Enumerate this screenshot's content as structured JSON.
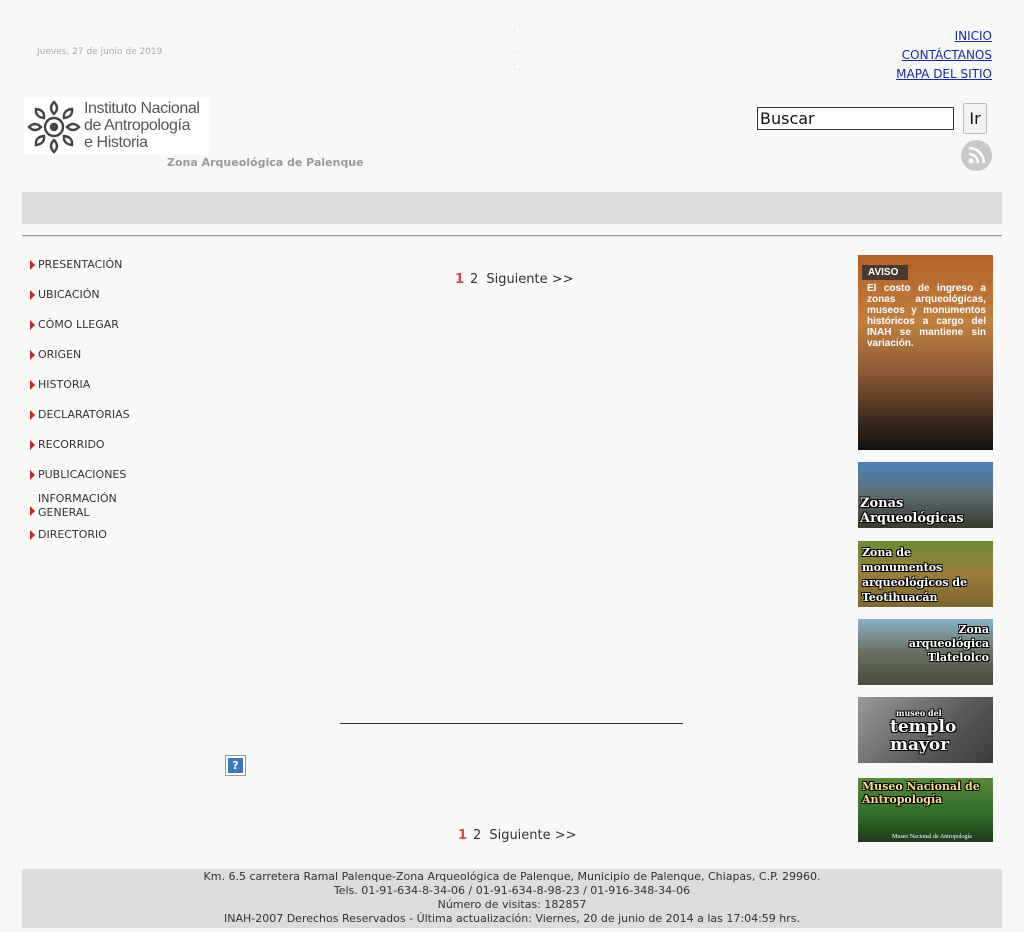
{
  "header": {
    "date": "Jueves, 27 de junio de 2019",
    "links": [
      "INICIO",
      "CONTÁCTANOS",
      "MAPA DEL SITIO"
    ],
    "logo_lines": [
      "Instituto Nacional",
      "de Antropología",
      "e Historia"
    ],
    "subtitle": "Zona Arqueológica de Palenque",
    "search": {
      "value": "Buscar",
      "button": "Ir"
    },
    "rss_icon": "rss-icon"
  },
  "sidebar": {
    "items": [
      {
        "label": "PRESENTACIÓN"
      },
      {
        "label": "UBICACIÓN"
      },
      {
        "label": "CÓMO LLEGAR"
      },
      {
        "label": "ORIGEN"
      },
      {
        "label": "HISTORIA"
      },
      {
        "label": "DECLARATORIAS"
      },
      {
        "label": "RECORRIDO"
      },
      {
        "label": "PUBLICACIONES"
      },
      {
        "label": "INFORMACIÓN GENERAL"
      },
      {
        "label": "DIRECTORIO"
      }
    ]
  },
  "pager": {
    "current": "1",
    "next_page": "2",
    "next": "Siguiente >>"
  },
  "help_icon": "question-icon",
  "banners": {
    "aviso_tag": "AVISO",
    "aviso_text": "El costo de ingreso a zonas arqueológicas, museos y monumentos históricos a cargo del INAH se mantiene sin variación.",
    "zonas": "Zonas Arqueológicas",
    "teotihuacan": "Zona de monumentos arqueológicos de Teotihuacán",
    "tlatelolco": "Zona arqueológica Tlatelolco",
    "templo_small": "museo del",
    "templo": "templo mayor",
    "mna": "Museo Nacional de Antropología",
    "mna_small": "Museo Nacional de Antropología"
  },
  "footer": {
    "lines": [
      "Km. 6.5 carretera Ramal Palenque-Zona Arqueológica de Palenque, Municipio de Palenque, Chiapas, C.P. 29960.",
      "Tels. 01-91-634-8-34-06 / 01-91-634-8-98-23 / 01-916-348-34-06",
      "Número de visitas: 182857",
      "INAH-2007 Derechos Reservados -  Última actualización: Viernes, 20 de junio de 2014 a las 17:04:59 hrs."
    ]
  },
  "colors": {
    "link": "#1a2a9a",
    "accent_red": "#c62828",
    "band_gray": "#dcdcdc"
  }
}
